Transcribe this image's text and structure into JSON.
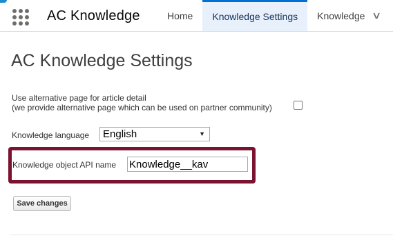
{
  "navbar": {
    "app_name": "AC Knowledge",
    "tabs": [
      {
        "label": "Home"
      },
      {
        "label": "Knowledge Settings"
      },
      {
        "label": "Knowledge"
      }
    ],
    "icons": {
      "launcher": "app-launcher-grid-icon",
      "overflow": "chevron-down-icon"
    },
    "chevron_glyph": "∨"
  },
  "page": {
    "title": "AC Knowledge Settings",
    "alt_page": {
      "label_line1": "Use alternative page for article detail",
      "label_line2": "(we provide alternative page which can be used on partner community)",
      "checked": false
    },
    "language": {
      "label": "Knowledge language",
      "selected": "English",
      "arrow": "▼"
    },
    "api_name": {
      "label": "Knowledge object API name",
      "value": "Knowledge__kav"
    },
    "save_label": "Save changes"
  },
  "colors": {
    "highlight_border": "#7a1230",
    "active_tab_bg": "#e8f1fb",
    "active_tab_border": "#0070d2"
  }
}
